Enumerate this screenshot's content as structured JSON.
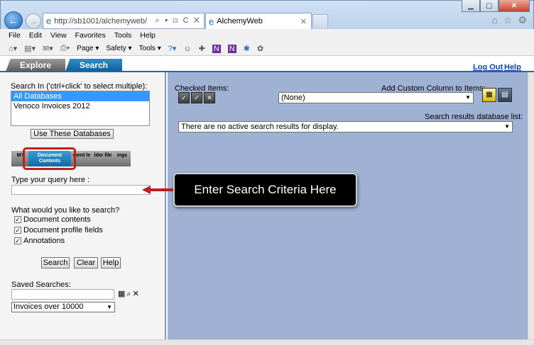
{
  "browser": {
    "url": "http://sb1001/alchemyweb/",
    "address_controls": "⌕ ▾ ⊡ C ✕",
    "tab_title": "AlchemyWeb",
    "menu": [
      "File",
      "Edit",
      "View",
      "Favorites",
      "Tools",
      "Help"
    ],
    "commands": [
      "Page ▾",
      "Safety ▾",
      "Tools ▾"
    ]
  },
  "app": {
    "tabs": {
      "explore": "Explore",
      "search": "Search"
    },
    "links": {
      "logout": "Log Out",
      "help": "Help"
    }
  },
  "left": {
    "search_in_label": "Search In ('ctrl+click' to select multiple):",
    "databases": [
      "All Databases",
      "Venoco Invoices 2012"
    ],
    "use_db_button": "Use These Databases",
    "subtabs": {
      "doc_contents": "Document Contents",
      "t1": "MY",
      "t2": "ment le",
      "t3": "lder file",
      "t4": "ings"
    },
    "query_label": "Type your query here :",
    "query_value": "",
    "what_label": "What would you like to search?",
    "checkboxes": [
      {
        "label": "Document contents",
        "checked": true
      },
      {
        "label": "Document profile fields",
        "checked": true
      },
      {
        "label": "Annotations",
        "checked": true
      }
    ],
    "buttons": {
      "search": "Search",
      "clear": "Clear",
      "help": "Help"
    },
    "saved_label": "Saved Searches:",
    "saved_value": "",
    "saved_select": "Invoices over 10000"
  },
  "right": {
    "checked_label": "Checked Items:",
    "custom_label": "Add Custom Column to Items:",
    "custom_select": "(None)",
    "results_db_label": "Search results database list:",
    "results_select": "There are no active search results for display."
  },
  "callout": "Enter Search Criteria Here",
  "colors": {
    "accent": "#1d6aa6",
    "callout_arrow": "#c01f1f",
    "right_bg": "#9fb2d3"
  }
}
